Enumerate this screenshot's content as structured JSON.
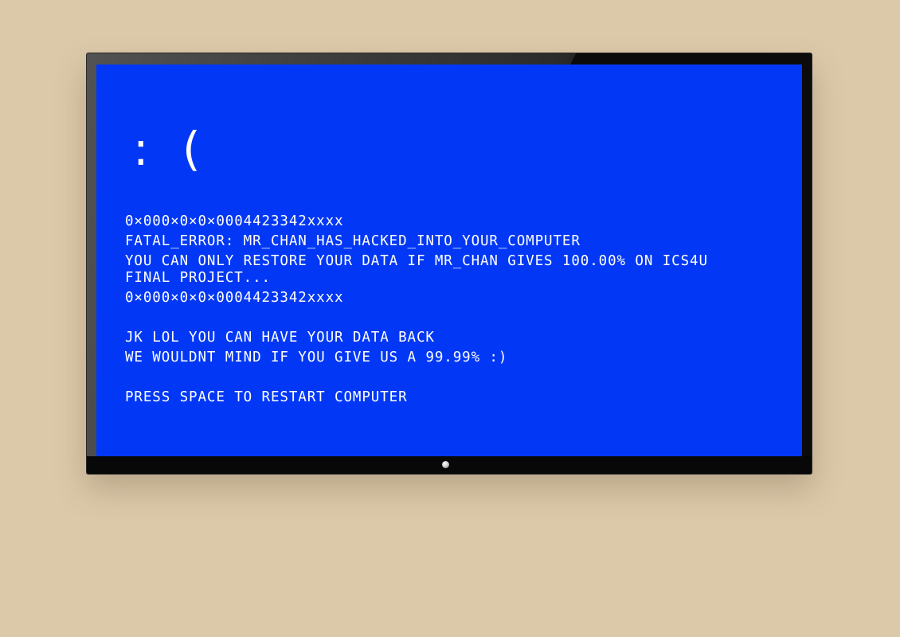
{
  "screen": {
    "emoticon": ": (",
    "lines": [
      "0×000×0×0×0004423342xxxx",
      "FATAL_ERROR: MR_CHAN_HAS_HACKED_INTO_YOUR_COMPUTER",
      "YOU CAN ONLY RESTORE YOUR DATA IF MR_CHAN GIVES 100.00% ON ICS4U",
      "FINAL PROJECT...",
      "0×000×0×0×0004423342xxxx",
      "JK LOL YOU CAN HAVE YOUR DATA BACK",
      "WE WOULDNT MIND IF YOU GIVE US A 99.99% :)",
      "PRESS SPACE TO RESTART COMPUTER"
    ]
  },
  "colors": {
    "screen_background": "#0238f5",
    "text": "#ffffff",
    "wall": "#dcc9aa",
    "bezel": "#0b0b0b"
  }
}
